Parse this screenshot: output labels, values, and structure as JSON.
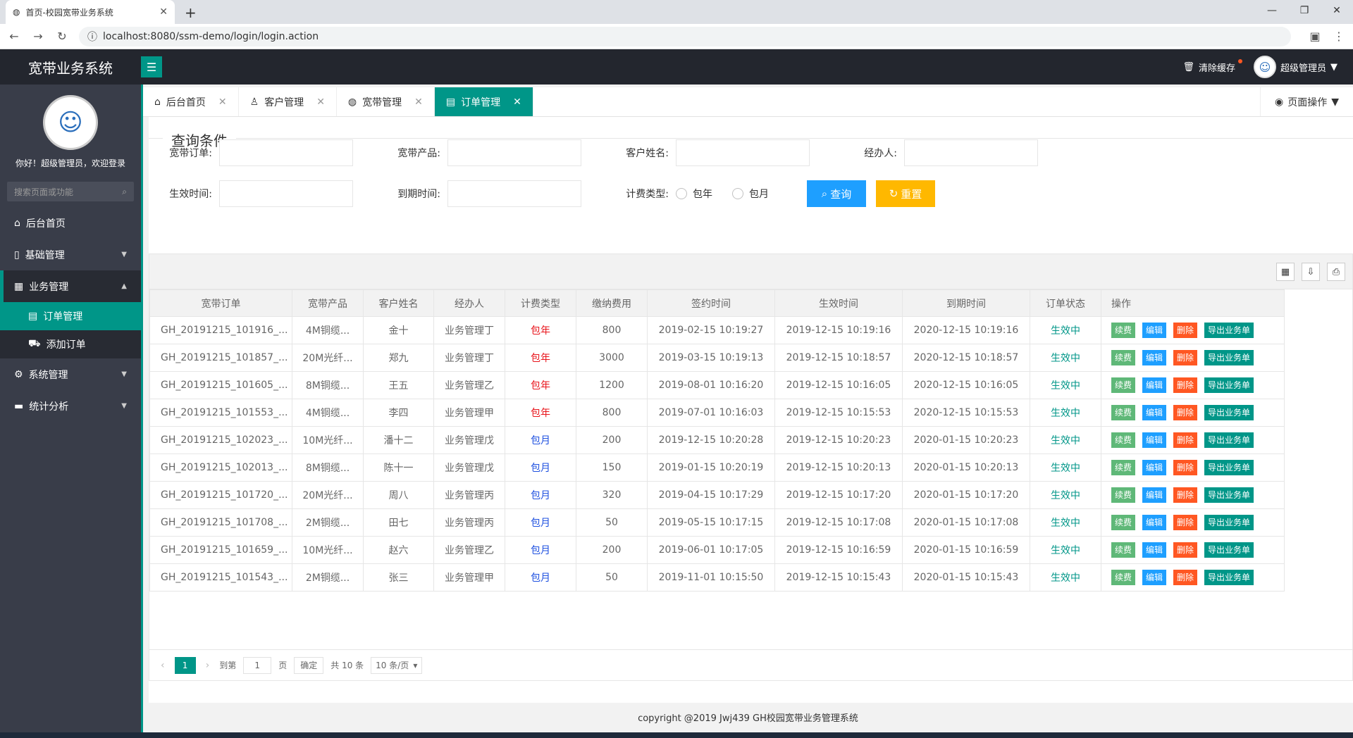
{
  "browser": {
    "tab_title": "首页-校园宽带业务系统",
    "url": "localhost:8080/ssm-demo/login/login.action"
  },
  "header": {
    "logo": "宽带业务系统",
    "clear_cache": "清除缓存",
    "user": "超级管理员"
  },
  "sidebar": {
    "welcome": "你好！超级管理员，欢迎登录",
    "search_placeholder": "搜索页面或功能",
    "items": [
      {
        "label": "后台首页"
      },
      {
        "label": "基础管理"
      },
      {
        "label": "业务管理"
      },
      {
        "label": "系统管理"
      },
      {
        "label": "统计分析"
      }
    ],
    "sub_items": [
      {
        "label": "订单管理"
      },
      {
        "label": "添加订单"
      }
    ]
  },
  "tabs": [
    {
      "label": "后台首页"
    },
    {
      "label": "客户管理"
    },
    {
      "label": "宽带管理"
    },
    {
      "label": "订单管理"
    }
  ],
  "page_ops": "页面操作",
  "query": {
    "legend": "查询条件",
    "order_label": "宽带订单:",
    "product_label": "宽带产品:",
    "customer_label": "客户姓名:",
    "agent_label": "经办人:",
    "start_label": "生效时间:",
    "end_label": "到期时间:",
    "billing_label": "计费类型:",
    "billing_options": [
      "包年",
      "包月"
    ],
    "query_btn": "查询",
    "reset_btn": "重置"
  },
  "table": {
    "headers": [
      "宽带订单",
      "宽带产品",
      "客户姓名",
      "经办人",
      "计费类型",
      "缴纳费用",
      "签约时间",
      "生效时间",
      "到期时间",
      "订单状态",
      "操作"
    ],
    "ops": [
      "续费",
      "编辑",
      "删除",
      "导出业务单"
    ],
    "rows": [
      [
        "GH_20191215_101916_...",
        "4M铜缆...",
        "金十",
        "业务管理丁",
        "包年",
        "800",
        "2019-02-15 10:19:27",
        "2019-12-15 10:19:16",
        "2020-12-15 10:19:16",
        "生效中"
      ],
      [
        "GH_20191215_101857_...",
        "20M光纤...",
        "郑九",
        "业务管理丁",
        "包年",
        "3000",
        "2019-03-15 10:19:13",
        "2019-12-15 10:18:57",
        "2020-12-15 10:18:57",
        "生效中"
      ],
      [
        "GH_20191215_101605_...",
        "8M铜缆...",
        "王五",
        "业务管理乙",
        "包年",
        "1200",
        "2019-08-01 10:16:20",
        "2019-12-15 10:16:05",
        "2020-12-15 10:16:05",
        "生效中"
      ],
      [
        "GH_20191215_101553_...",
        "4M铜缆...",
        "李四",
        "业务管理甲",
        "包年",
        "800",
        "2019-07-01 10:16:03",
        "2019-12-15 10:15:53",
        "2020-12-15 10:15:53",
        "生效中"
      ],
      [
        "GH_20191215_102023_...",
        "10M光纤...",
        "潘十二",
        "业务管理戊",
        "包月",
        "200",
        "2019-12-15 10:20:28",
        "2019-12-15 10:20:23",
        "2020-01-15 10:20:23",
        "生效中"
      ],
      [
        "GH_20191215_102013_...",
        "8M铜缆...",
        "陈十一",
        "业务管理戊",
        "包月",
        "150",
        "2019-01-15 10:20:19",
        "2019-12-15 10:20:13",
        "2020-01-15 10:20:13",
        "生效中"
      ],
      [
        "GH_20191215_101720_...",
        "20M光纤...",
        "周八",
        "业务管理丙",
        "包月",
        "320",
        "2019-04-15 10:17:29",
        "2019-12-15 10:17:20",
        "2020-01-15 10:17:20",
        "生效中"
      ],
      [
        "GH_20191215_101708_...",
        "2M铜缆...",
        "田七",
        "业务管理丙",
        "包月",
        "50",
        "2019-05-15 10:17:15",
        "2019-12-15 10:17:08",
        "2020-01-15 10:17:08",
        "生效中"
      ],
      [
        "GH_20191215_101659_...",
        "10M光纤...",
        "赵六",
        "业务管理乙",
        "包月",
        "200",
        "2019-06-01 10:17:05",
        "2019-12-15 10:16:59",
        "2020-01-15 10:16:59",
        "生效中"
      ],
      [
        "GH_20191215_101543_...",
        "2M铜缆...",
        "张三",
        "业务管理甲",
        "包月",
        "50",
        "2019-11-01 10:15:50",
        "2019-12-15 10:15:43",
        "2020-01-15 10:15:43",
        "生效中"
      ]
    ]
  },
  "pager": {
    "current": "1",
    "goto_label": "到第",
    "goto_value": "1",
    "page_unit": "页",
    "confirm": "确定",
    "total": "共 10 条",
    "per_page": "10 条/页"
  },
  "footer": "copyright @2019 Jwj439 GH校园宽带业务管理系统",
  "colors": {
    "accent": "#009688",
    "query": "#1e9fff",
    "reset": "#ffb800",
    "delete": "#ff5722",
    "renew": "#5fb878"
  }
}
